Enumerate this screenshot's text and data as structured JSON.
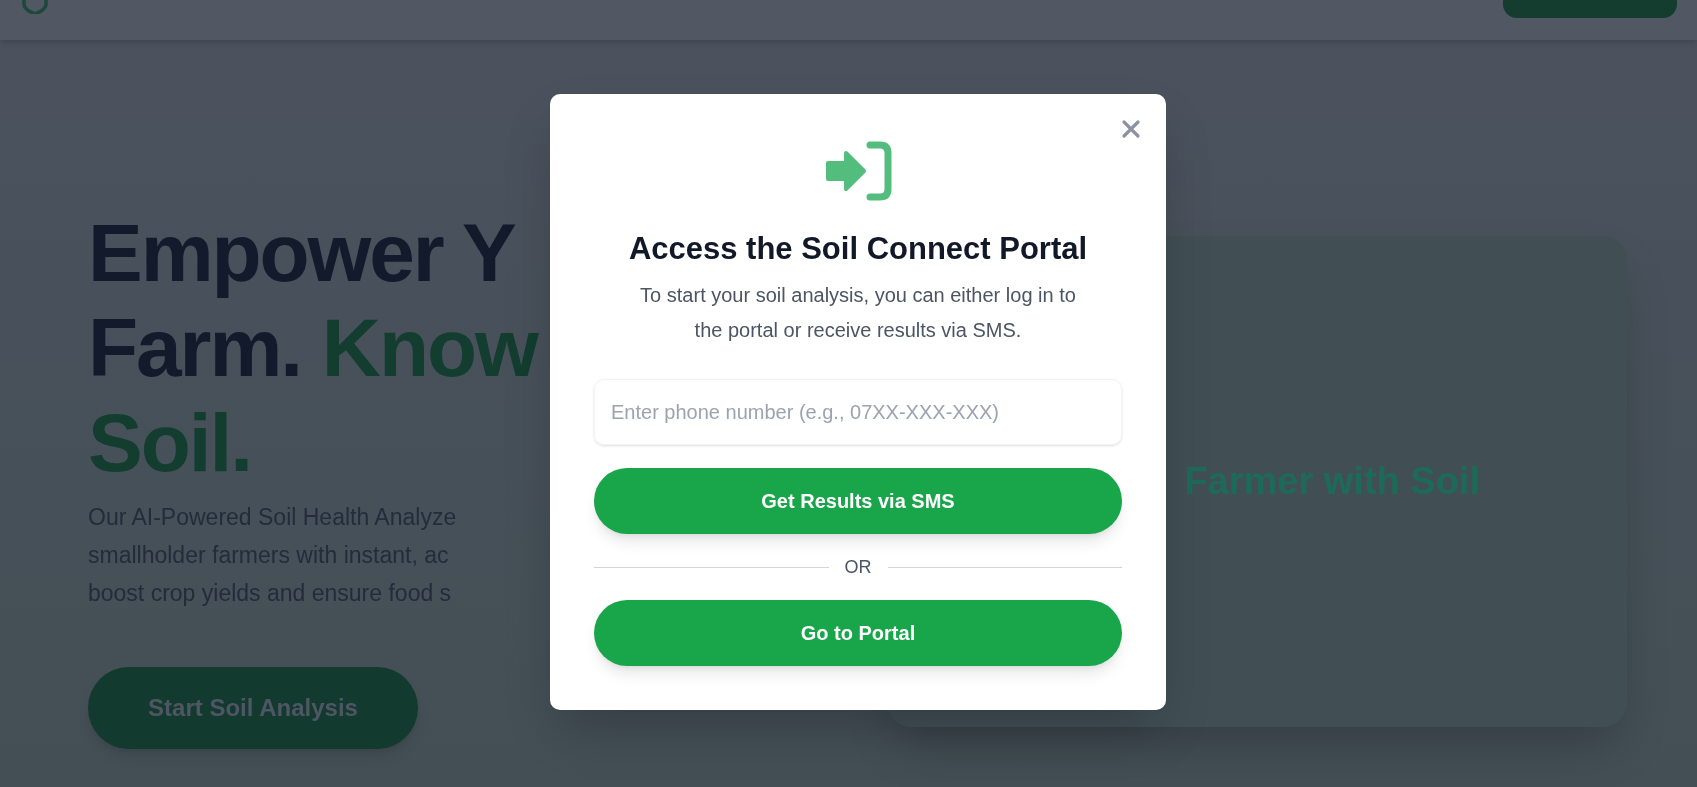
{
  "hero": {
    "heading_line_1": "Empower Y",
    "heading_line_2": "Farm.",
    "heading_line_2_accent": "Know",
    "heading_line_3_accent": "Soil.",
    "description_lines": [
      "Our AI-Powered Soil Health Analyze",
      "smallholder farmers with instant, ac",
      "boost crop yields and ensure food s"
    ],
    "cta_button": "Start Soil Analysis"
  },
  "card": {
    "caption": "Farmer with Soil"
  },
  "modal": {
    "title": "Access the Soil Connect Portal",
    "subtitle_lines": [
      "To start your soil analysis, you can either log in to",
      "the portal or receive results via SMS."
    ],
    "phone_field": {
      "placeholder": "Enter phone number (e.g., 07XX-XXX-XXX)"
    },
    "sms_button": "Get Results via SMS",
    "divider_label": "OR",
    "portal_button": "Go to Portal"
  }
}
